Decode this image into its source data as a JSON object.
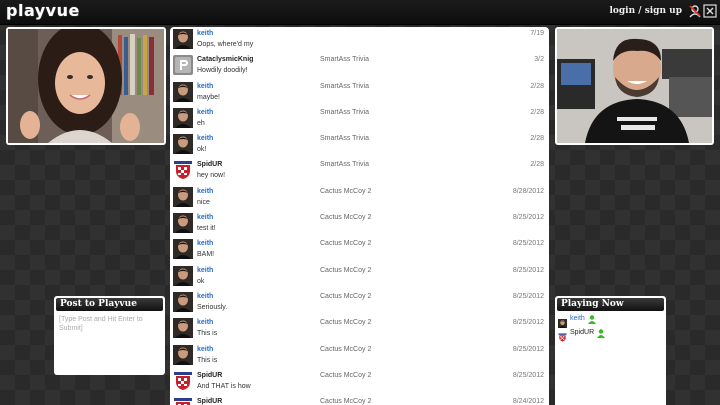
{
  "app": {
    "logo": "playvue",
    "auth_text": "login / sign up"
  },
  "post_panel": {
    "title": "Post to Playvue",
    "placeholder": "[Type Post and Hit Enter to Submit]"
  },
  "playing_panel": {
    "title": "Playing Now",
    "players": [
      {
        "name": "keith",
        "name_color": "#2a6fc4",
        "avatar": "keith"
      },
      {
        "name": "SpidUR",
        "name_color": "#222222",
        "avatar": "spidur"
      }
    ]
  },
  "colors": {
    "keith": "#2a6fc4",
    "controller": "#33bb22"
  },
  "feed": [
    {
      "user": "keith",
      "avatar": "keith",
      "message": "Oops, where'd my",
      "game": "",
      "date": "7/19"
    },
    {
      "user": "CataclysmicKnig",
      "avatar": "default",
      "message": "Howdily doodily!",
      "game": "SmartAss Trivia",
      "date": "3/2"
    },
    {
      "user": "keith",
      "avatar": "keith",
      "message": "maybe!",
      "game": "SmartAss Trivia",
      "date": "2/28"
    },
    {
      "user": "keith",
      "avatar": "keith",
      "message": "eh",
      "game": "SmartAss Trivia",
      "date": "2/28"
    },
    {
      "user": "keith",
      "avatar": "keith",
      "message": "ok!",
      "game": "SmartAss Trivia",
      "date": "2/28"
    },
    {
      "user": "SpidUR",
      "avatar": "spidur",
      "message": "hey now!",
      "game": "SmartAss Trivia",
      "date": "2/28"
    },
    {
      "user": "keith",
      "avatar": "keith",
      "message": "nice",
      "game": "Cactus McCoy 2",
      "date": "8/28/2012"
    },
    {
      "user": "keith",
      "avatar": "keith",
      "message": "test it!",
      "game": "Cactus McCoy 2",
      "date": "8/25/2012"
    },
    {
      "user": "keith",
      "avatar": "keith",
      "message": "BAM!",
      "game": "Cactus McCoy 2",
      "date": "8/25/2012"
    },
    {
      "user": "keith",
      "avatar": "keith",
      "message": "ok",
      "game": "Cactus McCoy 2",
      "date": "8/25/2012"
    },
    {
      "user": "keith",
      "avatar": "keith",
      "message": "Seriously.",
      "game": "Cactus McCoy 2",
      "date": "8/25/2012"
    },
    {
      "user": "keith",
      "avatar": "keith",
      "message": "This is",
      "game": "Cactus McCoy 2",
      "date": "8/25/2012"
    },
    {
      "user": "keith",
      "avatar": "keith",
      "message": "This is",
      "game": "Cactus McCoy 2",
      "date": "8/25/2012"
    },
    {
      "user": "SpidUR",
      "avatar": "spidur",
      "message": "And THAT is how",
      "game": "Cactus McCoy 2",
      "date": "8/25/2012"
    },
    {
      "user": "SpidUR",
      "avatar": "spidur",
      "message": "",
      "game": "Cactus McCoy 2",
      "date": "8/24/2012"
    }
  ]
}
